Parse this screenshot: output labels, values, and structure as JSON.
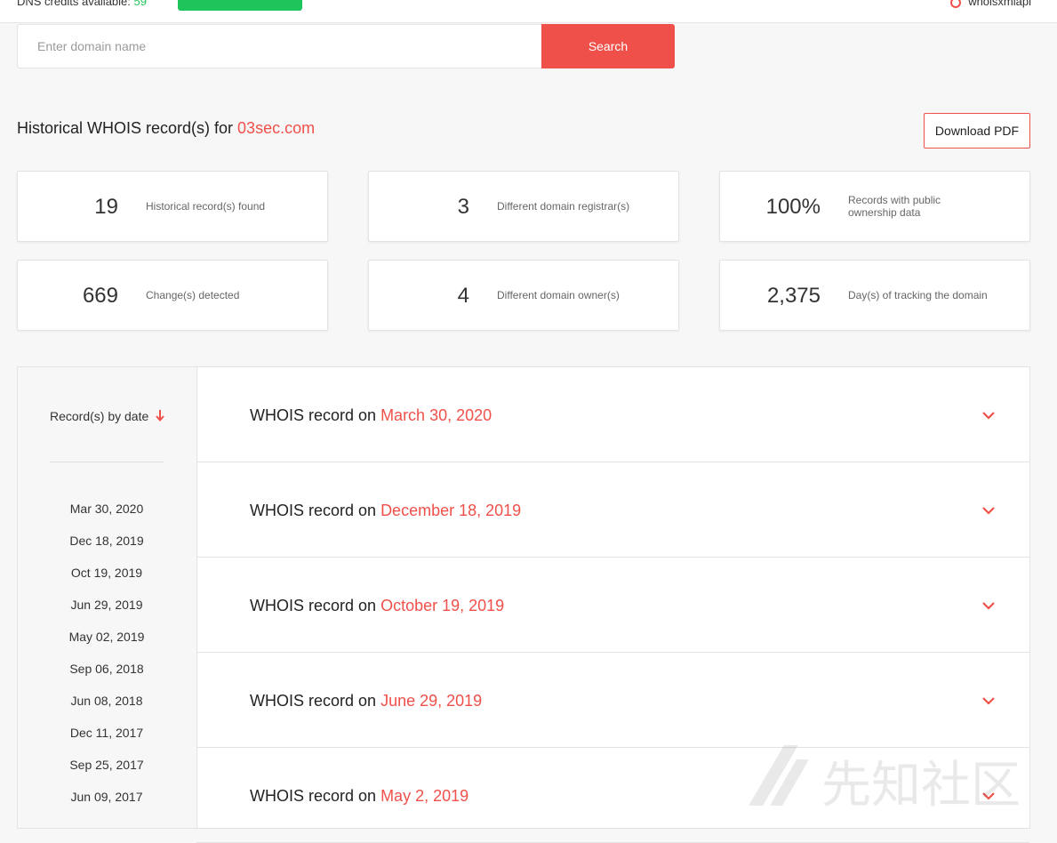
{
  "topbar": {
    "dns_credits_label": "DNS credits available:",
    "dns_credits_value": "59",
    "account_label": "whoisxmlapi"
  },
  "search": {
    "placeholder": "Enter domain name",
    "button_label": "Search"
  },
  "heading": {
    "prefix": "Historical WHOIS record(s) for",
    "domain": "03sec.com"
  },
  "download_pdf_label": "Download PDF",
  "stats": [
    {
      "value": "19",
      "label": "Historical record(s) found"
    },
    {
      "value": "3",
      "label": "Different domain registrar(s)"
    },
    {
      "value": "100%",
      "label": "Records with public ownership data"
    },
    {
      "value": "669",
      "label": "Change(s) detected"
    },
    {
      "value": "4",
      "label": "Different domain owner(s)"
    },
    {
      "value": "2,375",
      "label": "Day(s) of tracking the domain"
    }
  ],
  "sidebar": {
    "header": "Record(s) by date",
    "dates": [
      "Mar 30, 2020",
      "Dec 18, 2019",
      "Oct 19, 2019",
      "Jun 29, 2019",
      "May 02, 2019",
      "Sep 06, 2018",
      "Jun 08, 2018",
      "Dec 11, 2017",
      "Sep 25, 2017",
      "Jun 09, 2017"
    ]
  },
  "records": {
    "title_prefix": "WHOIS record on",
    "items": [
      {
        "date": "March 30, 2020"
      },
      {
        "date": "December 18, 2019"
      },
      {
        "date": "October 19, 2019"
      },
      {
        "date": "June 29, 2019"
      },
      {
        "date": "May 2, 2019"
      }
    ]
  },
  "watermark": "先知社区",
  "colors": {
    "accent": "#f0504a",
    "green": "#1fc55a",
    "border": "#e3e3e3",
    "background": "#f7f7f7"
  }
}
